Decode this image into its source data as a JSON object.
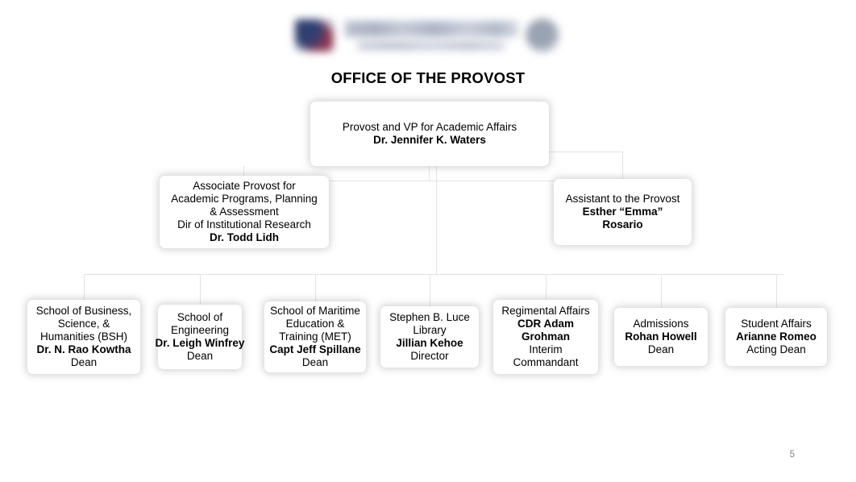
{
  "document": {
    "title": "OFFICE OF THE PROVOST",
    "page_number": "5",
    "logo": {
      "flag_icon": "flag-icon",
      "seal_icon": "seal-icon",
      "wordmark_alt": "university-wordmark",
      "tagline_alt": "university-tagline"
    },
    "colors": {
      "text": "#000000",
      "box_fill": "#ffffff",
      "box_shadow": "#8c8c8c",
      "connector": "#e3e3e3",
      "page_number": "#808080",
      "logo_blue": "#2f3f70",
      "logo_red": "#8e3752"
    }
  },
  "chart_data": {
    "type": "diagram",
    "subtype": "organizational-chart",
    "title": "OFFICE OF THE PROVOST",
    "levels": [
      {
        "level": 1,
        "nodes": [
          {
            "id": "provost",
            "role": "Provost and VP for Academic Affairs",
            "name": "Dr. Jennifer K. Waters",
            "sub": ""
          }
        ]
      },
      {
        "level": 2,
        "nodes": [
          {
            "id": "assoc-provost",
            "role_line_1": "Associate Provost for",
            "role_line_2": "Academic Programs, Planning",
            "role_line_3": "& Assessment",
            "role_line_4": "Dir of Institutional Research",
            "name": "Dr. Todd Lidh",
            "sub": ""
          },
          {
            "id": "assistant-provost",
            "role": "Assistant to the Provost",
            "name_line_1": "Esther “Emma”",
            "name_line_2": "Rosario",
            "sub": ""
          }
        ]
      },
      {
        "level": 3,
        "nodes": [
          {
            "id": "bsh",
            "role_line_1": "School of Business,",
            "role_line_2": "Science, &",
            "role_line_3": "Humanities (BSH)",
            "name": "Dr. N. Rao Kowtha",
            "sub": "Dean"
          },
          {
            "id": "engineering",
            "role_line_1": "School of",
            "role_line_2": "Engineering",
            "name": "Dr. Leigh Winfrey",
            "sub": "Dean"
          },
          {
            "id": "met",
            "role_line_1": "School of Maritime",
            "role_line_2": "Education &",
            "role_line_3": "Training (MET)",
            "name": "Capt Jeff Spillane",
            "sub": "Dean"
          },
          {
            "id": "library",
            "role_line_1": "Stephen B. Luce",
            "role_line_2": "Library",
            "name": "Jillian Kehoe",
            "sub": "Director"
          },
          {
            "id": "regimental-affairs",
            "role": "Regimental Affairs",
            "name_line_1": "CDR Adam",
            "name_line_2": "Grohman",
            "sub_line_1": "Interim",
            "sub_line_2": "Commandant"
          },
          {
            "id": "admissions",
            "role": "Admissions",
            "name": "Rohan Howell",
            "sub": "Dean"
          },
          {
            "id": "student-affairs",
            "role": "Student Affairs",
            "name": "Arianne Romeo",
            "sub": "Acting Dean"
          }
        ]
      }
    ]
  }
}
